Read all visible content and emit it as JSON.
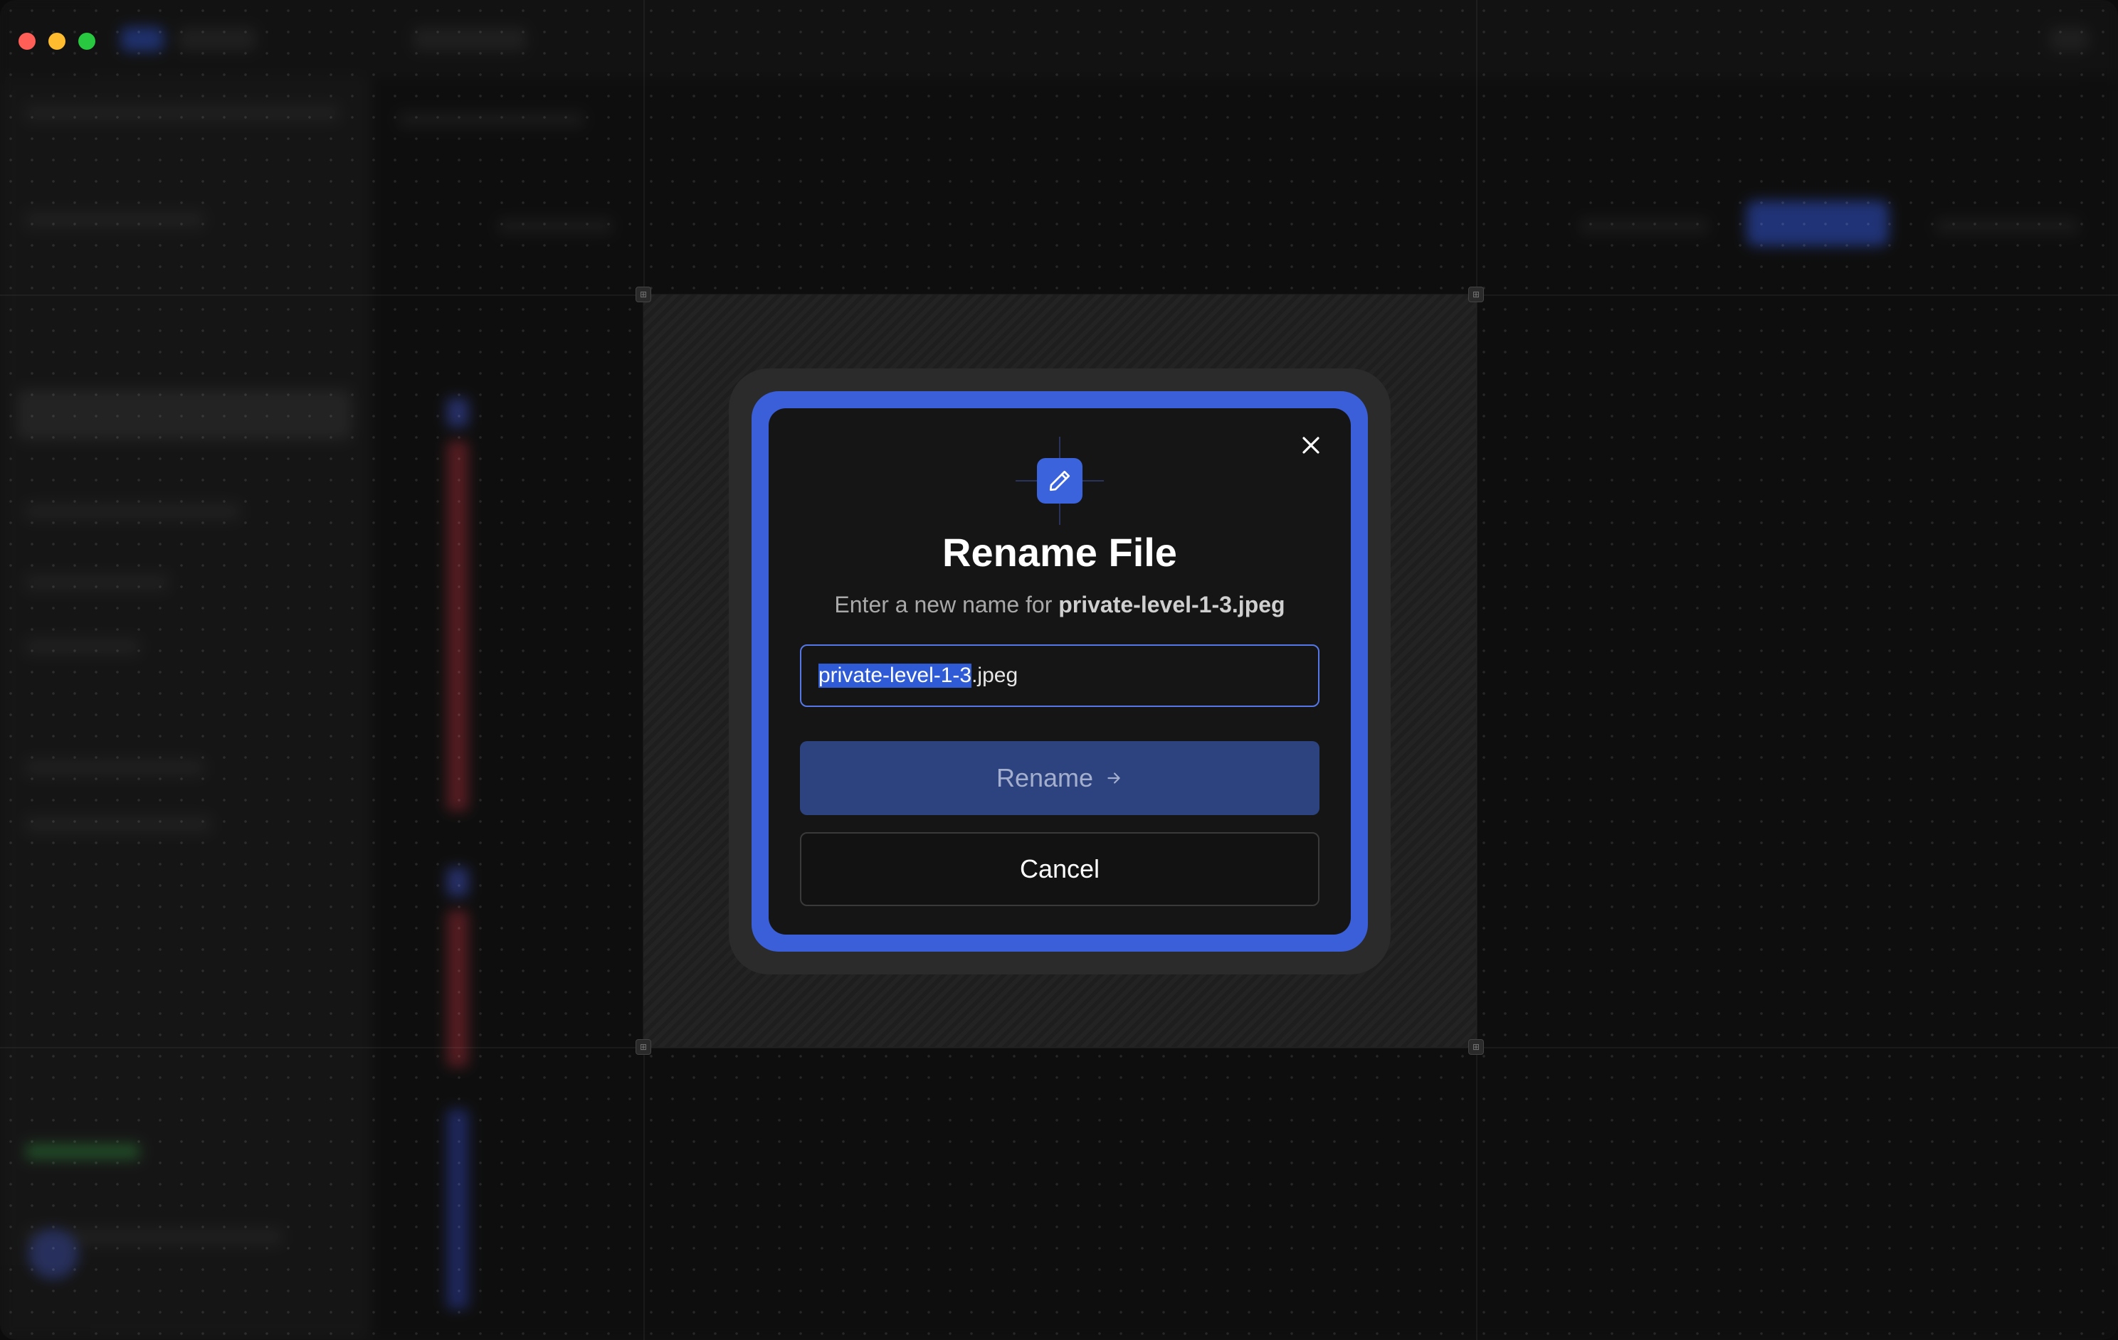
{
  "dialog": {
    "title": "Rename File",
    "subtitle_prefix": "Enter a new name for",
    "file_name": "private-level-1-3.jpeg",
    "input": {
      "selected_part": "private-level-1-3",
      "unselected_part": ".jpeg"
    },
    "rename_label": "Rename",
    "rename_icon": "arrow-right-icon",
    "cancel_label": "Cancel",
    "close_icon": "close-icon",
    "header_icon": "pencil-icon"
  },
  "colors": {
    "accent": "#3a5fd9",
    "rename_button_bg": "#2d4380",
    "dialog_bg": "#151515"
  }
}
